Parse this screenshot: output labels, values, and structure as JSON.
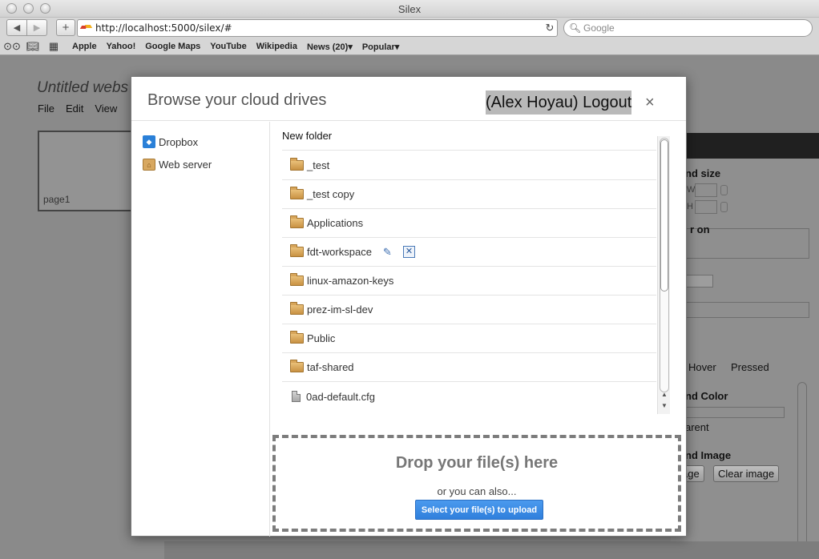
{
  "browser": {
    "window_title": "Silex",
    "url": "http://localhost:5000/silex/#",
    "search_placeholder": "Google",
    "bookmarks": [
      "Apple",
      "Yahoo!",
      "Google Maps",
      "YouTube",
      "Wikipedia",
      "News (20)▾",
      "Popular▾"
    ]
  },
  "app": {
    "site_title": "Untitled webs",
    "menu": [
      "File",
      "Edit",
      "View"
    ],
    "page_label": "page1",
    "panel": {
      "bg_size_label": "nd size",
      "w_label": "W",
      "h_label": "H",
      "r_on_label": "r on",
      "hover_tab": "Hover",
      "pressed_tab": "Pressed",
      "bg_color_label": "nd Color",
      "transparent_label": "arent",
      "bg_image_label": "nd Image",
      "image_btn": "age",
      "clear_image_btn": "Clear image"
    }
  },
  "dialog": {
    "title": "Browse your cloud drives",
    "logout": "(Alex Hoyau) Logout",
    "close": "×",
    "services": [
      {
        "label": "Dropbox"
      },
      {
        "label": "Web server"
      }
    ],
    "new_folder": "New folder",
    "files": [
      {
        "name": "_test",
        "type": "folder"
      },
      {
        "name": "_test copy",
        "type": "folder"
      },
      {
        "name": "Applications",
        "type": "folder"
      },
      {
        "name": "fdt-workspace",
        "type": "folder"
      },
      {
        "name": "linux-amazon-keys",
        "type": "folder"
      },
      {
        "name": "prez-im-sl-dev",
        "type": "folder"
      },
      {
        "name": "Public",
        "type": "folder"
      },
      {
        "name": "taf-shared",
        "type": "folder"
      },
      {
        "name": "0ad-default.cfg",
        "type": "file"
      }
    ],
    "dropzone": {
      "title": "Drop your file(s) here",
      "subtitle": "or you can also...",
      "button": "Select your file(s) to upload"
    }
  }
}
